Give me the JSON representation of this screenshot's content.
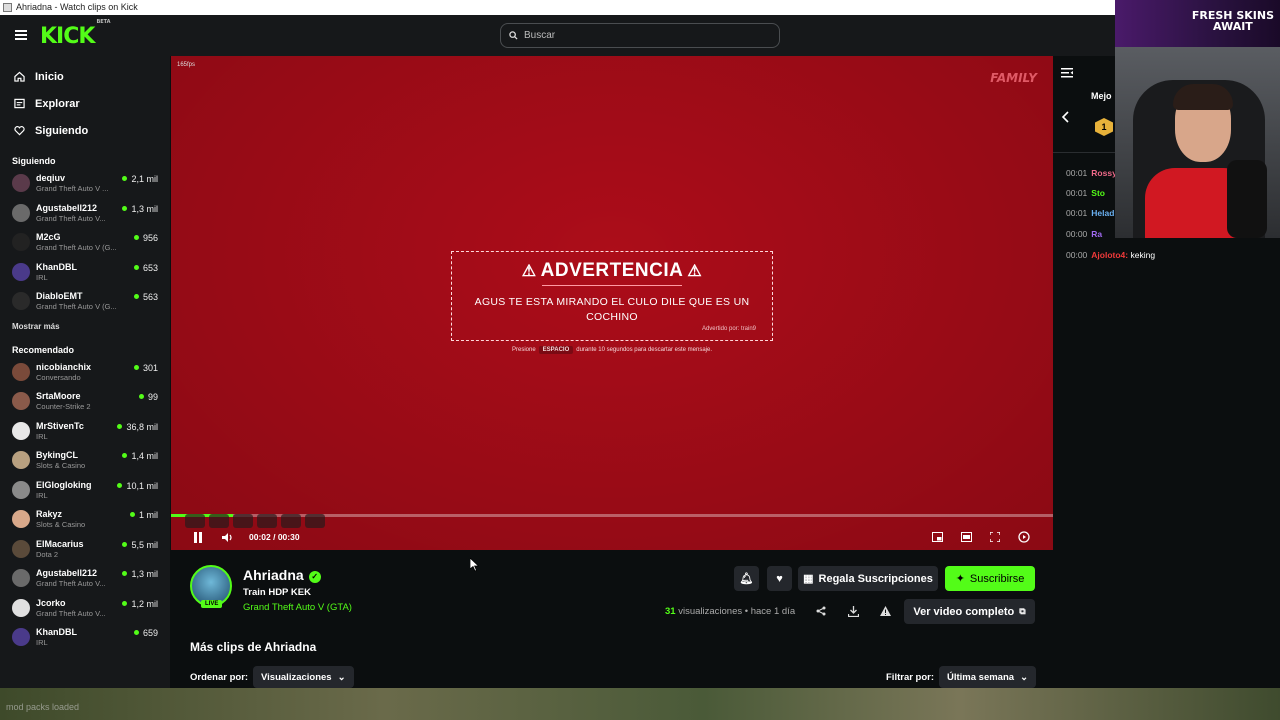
{
  "window": {
    "title": "Ahriadna - Watch clips on Kick"
  },
  "header": {
    "logo": "KICK",
    "logo_sup": "BETA",
    "search_placeholder": "Buscar"
  },
  "sidebar": {
    "nav": [
      {
        "label": "Inicio",
        "icon": "home-icon"
      },
      {
        "label": "Explorar",
        "icon": "explore-icon"
      },
      {
        "label": "Siguiendo",
        "icon": "heart-icon"
      }
    ],
    "following_title": "Siguiendo",
    "following": [
      {
        "name": "deqiuv",
        "category": "Grand Theft Auto V ...",
        "viewers": "2,1 mil",
        "color": "#5a3a4a"
      },
      {
        "name": "Agustabell212",
        "category": "Grand Theft Auto V...",
        "viewers": "1,3 mil",
        "color": "#6a6a6a"
      },
      {
        "name": "M2cG",
        "category": "Grand Theft Auto V (G...",
        "viewers": "956",
        "color": "#222222"
      },
      {
        "name": "KhanDBL",
        "category": "IRL",
        "viewers": "653",
        "color": "#4a3a8a"
      },
      {
        "name": "DiabloEMT",
        "category": "Grand Theft Auto V (G...",
        "viewers": "563",
        "color": "#2a2a2a"
      }
    ],
    "show_more": "Mostrar más",
    "recommended_title": "Recomendado",
    "recommended": [
      {
        "name": "nicobianchix",
        "category": "Conversando",
        "viewers": "301",
        "color": "#7a4a3a"
      },
      {
        "name": "SrtaMoore",
        "category": "Counter-Strike 2",
        "viewers": "99",
        "color": "#8a5a4a"
      },
      {
        "name": "MrStivenTc",
        "category": "IRL",
        "viewers": "36,8 mil",
        "color": "#e8e8e8"
      },
      {
        "name": "BykingCL",
        "category": "Slots & Casino",
        "viewers": "1,4 mil",
        "color": "#b8a080"
      },
      {
        "name": "ElGlogloking",
        "category": "IRL",
        "viewers": "10,1 mil",
        "color": "#8a8a8a"
      },
      {
        "name": "Rakyz",
        "category": "Slots & Casino",
        "viewers": "1 mil",
        "color": "#d8a88a"
      },
      {
        "name": "ElMacarius",
        "category": "Dota 2",
        "viewers": "5,5 mil",
        "color": "#5a4a3a"
      },
      {
        "name": "Agustabell212",
        "category": "Grand Theft Auto V...",
        "viewers": "1,3 mil",
        "color": "#6a6a6a"
      },
      {
        "name": "Jcorko",
        "category": "Grand Theft Auto V...",
        "viewers": "1,2 mil",
        "color": "#e0e0e0"
      },
      {
        "name": "KhanDBL",
        "category": "IRL",
        "viewers": "659",
        "color": "#4a3a8a"
      }
    ]
  },
  "player": {
    "fps": "165fps",
    "watermark": "FAMILY",
    "warning_title": "ADVERTENCIA",
    "warning_message": "AGUS TE ESTA MIRANDO EL CULO DILE QUE ES UN COCHINO",
    "warning_by": "Advertido por: train9",
    "hint_before": "Presione",
    "hint_key": "ESPACIO",
    "hint_after": "durante 10 segundos para descartar este mensaje.",
    "time": "00:02 / 00:30",
    "progress": 0.07
  },
  "clip": {
    "streamer": "Ahriadna",
    "live": "LIVE",
    "title": "Train HDP KEK",
    "category": "Grand Theft Auto V (GTA)",
    "gift_label": "Regala Suscripciones",
    "subscribe_label": "Suscribirse",
    "views_count": "31",
    "views_label": "visualizaciones",
    "time_ago": "hace 1 día",
    "full_video_label": "Ver video completo",
    "more_clips": "Más clips de Ahriadna",
    "sort_label": "Ordenar por:",
    "sort_value": "Visualizaciones",
    "filter_label": "Filtrar por:",
    "filter_value": "Última semana"
  },
  "chat": {
    "pinned_title": "Mejo",
    "badge": "1",
    "messages": [
      {
        "time": "00:01",
        "user": "Rossy",
        "color": "#f06a8a",
        "text": ""
      },
      {
        "time": "00:01",
        "user": "Sto",
        "color": "#53fc18",
        "text": ""
      },
      {
        "time": "00:01",
        "user": "Helad",
        "color": "#6ab0f0",
        "text": ""
      },
      {
        "time": "00:00",
        "user": "Ra",
        "color": "#a06af0",
        "text": ""
      },
      {
        "time": "00:00",
        "user": "Ajoloto4:",
        "color": "#f03a3a",
        "text": "keking"
      }
    ]
  },
  "webcam": {
    "promo_line1": "FRESH SKINS",
    "promo_line2": "AWAIT"
  },
  "footer": {
    "text": "mod packs loaded"
  }
}
